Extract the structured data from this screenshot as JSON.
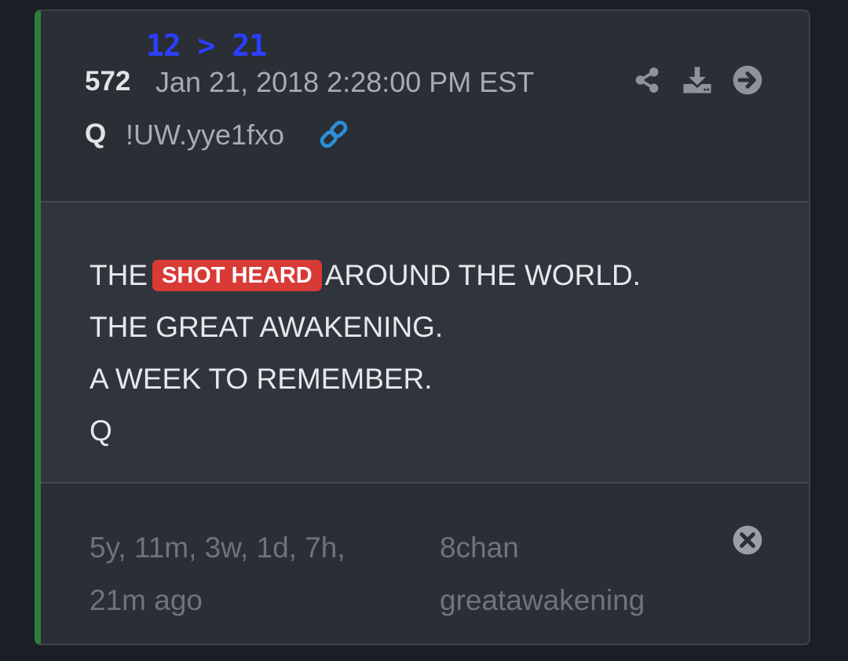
{
  "header": {
    "delta": "12 > 21",
    "post_number": "572",
    "date": "Jan 21, 2018 2:28:00 PM EST",
    "author": "Q",
    "tripcode": "!UW.yye1fxo",
    "action_icons": [
      "share-icon",
      "download-icon",
      "arrow-right-circle-icon"
    ],
    "link_icon": "link-icon"
  },
  "body": {
    "line1_before": "THE",
    "line1_highlight": "SHOT HEARD",
    "line1_after": "AROUND THE WORLD.",
    "line2": "THE GREAT AWAKENING.",
    "line3": "A WEEK TO REMEMBER.",
    "line4": "Q"
  },
  "footer": {
    "ago_line1": "5y, 11m, 3w, 1d, 7h,",
    "ago_line2": "21m ago",
    "source_line1": "8chan",
    "source_line2": "greatawakening",
    "close_icon": "close-circle-icon"
  },
  "colors": {
    "page_background": "#1b1e24",
    "card_background": "#2a2e35",
    "accent_bar": "#2f7d3a",
    "delta_text": "#2a3fff",
    "highlight_badge": "#d83a36",
    "link_icon": "#2a8fd8",
    "muted_text": "#6e737c"
  }
}
